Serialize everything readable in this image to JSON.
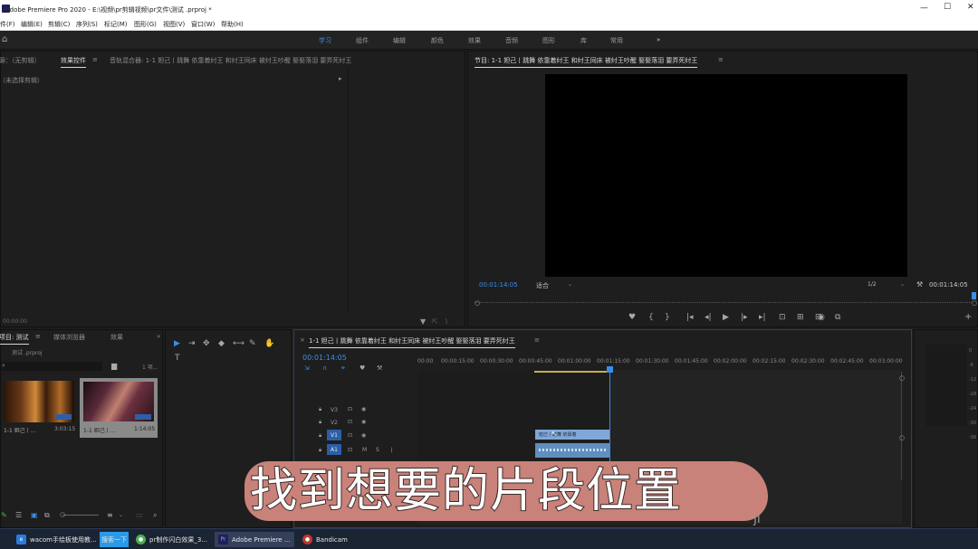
{
  "window": {
    "title": "Adobe Premiere Pro 2020 - E:\\视频\\pr剪辑视频\\pr文件\\测试 .prproj *",
    "controls": [
      "—",
      "☐",
      "✕"
    ]
  },
  "menu": [
    "件(F)",
    "编辑(E)",
    "剪辑(C)",
    "序列(S)",
    "标记(M)",
    "图形(G)",
    "视图(V)",
    "窗口(W)",
    "帮助(H)"
  ],
  "workspaces": [
    "学习",
    "组件",
    "编辑",
    "颜色",
    "效果",
    "音频",
    "图形",
    "库",
    "常用",
    "»"
  ],
  "workspace_active": "学习",
  "source_panel": {
    "tabs": [
      "源：（无剪辑）",
      "效果控件",
      "音轨混合器: 1-1 妲己丨跳舞 依靠着纣王 和纣王同床 被纣王吵醒 娶娶落泪 要弄死纣王"
    ],
    "menu_glyph": "≡",
    "no_clip": "（未选择剪辑）",
    "arrow": "▸",
    "bottom_time": "00:00:00"
  },
  "program_monitor": {
    "title": "节目: 1-1 妲己丨跳舞 依靠着纣王 和纣王同床 被纣王吵醒 娶娶落泪 要弄死纣王",
    "menu_glyph": "≡",
    "current_time": "00:01:14:05",
    "fit": "适合",
    "resolution": "1/2",
    "duration": "00:01:14:05",
    "transport": [
      "♥",
      "{",
      "}",
      "|◂",
      "◂|",
      "▶",
      "|▸",
      "▸|",
      "⊡",
      "⊞",
      "⊟",
      "◉",
      "⧉"
    ],
    "add": "+"
  },
  "project_panel": {
    "tabs": [
      "项目: 测试",
      "媒体浏览器",
      "效果"
    ],
    "menu_glyph": "≡",
    "more": "»",
    "file": "测试 .prproj",
    "count": "1 项...",
    "clips": [
      {
        "name": "1-1 妲己丨...",
        "duration": "3:03:15"
      },
      {
        "name": "1-1 妲己丨...",
        "duration": "1:14:05"
      }
    ]
  },
  "tools": [
    "▶",
    "⇥",
    "✥",
    "◆",
    "⟷",
    "✎",
    "✋",
    "T"
  ],
  "timeline": {
    "title": "1-1 妲己丨跳舞 依靠着纣王 和纣王同床 被纣王吵醒 娶娶落泪 要弄死纣王",
    "close": "×",
    "menu_glyph": "≡",
    "current_time": "00:01:14:05",
    "ruler": [
      "00:00",
      "00:00:15:00",
      "00:00:30:00",
      "00:00:45:00",
      "00:01:00:00",
      "00:01:15:00",
      "00:01:30:00",
      "00:01:45:00",
      "00:02:00:00",
      "00:02:15:00",
      "00:02:30:00",
      "00:02:45:00",
      "00:03:00:00"
    ],
    "tracks": [
      "V3",
      "V2",
      "V1",
      "A1"
    ],
    "clip_label": "妲己丨跳舞 依靠着"
  },
  "meter": {
    "labels": [
      "0",
      "-6",
      "-12",
      "-18",
      "-24",
      "-30",
      "-36"
    ]
  },
  "caption": "找到想要的片段位置",
  "watermark": "ji",
  "taskbar": [
    {
      "label": "wacom手绘板使用教...",
      "color": "#2a7be0",
      "icon": "e"
    },
    {
      "label": "搜索一下",
      "color": "#2a9ae8",
      "icon": ""
    },
    {
      "label": "pr制作闪白效果_3...",
      "color": "#4caf50",
      "icon": "●"
    },
    {
      "label": "Adobe Premiere ...",
      "color": "#1f1f5a",
      "icon": "Pr"
    },
    {
      "label": "Bandicam",
      "color": "#c0392b",
      "icon": "●"
    }
  ],
  "colors": {
    "accent": "#3b8ee8",
    "caption_bg": "#c8827a",
    "clip_video": "#7fa8d8",
    "clip_audio": "#5f8fbf"
  }
}
